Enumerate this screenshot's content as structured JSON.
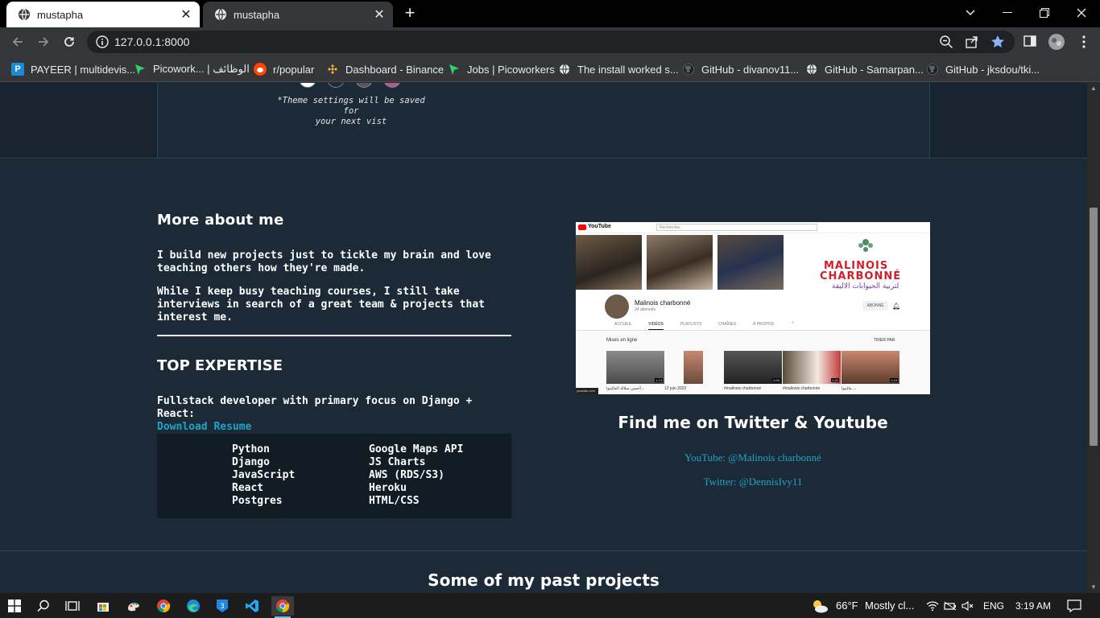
{
  "browser": {
    "tabs": [
      {
        "title": "mustapha",
        "active": false
      },
      {
        "title": "mustapha",
        "active": true
      }
    ],
    "url": "127.0.0.1:8000",
    "bookmarks": [
      {
        "label": "PAYEER | multidevis...",
        "icon": "payeer-icon"
      },
      {
        "label": "Picowork... | الوظائف",
        "icon": "picoworkers-icon"
      },
      {
        "label": "r/popular",
        "icon": "reddit-icon"
      },
      {
        "label": "Dashboard - Binance",
        "icon": "binance-icon"
      },
      {
        "label": "Jobs | Picoworkers",
        "icon": "picoworkers-icon"
      },
      {
        "label": "The install worked s...",
        "icon": "globe-icon"
      },
      {
        "label": "GitHub - divanov11...",
        "icon": "github-icon"
      },
      {
        "label": "GitHub - Samarpan...",
        "icon": "globe-icon"
      },
      {
        "label": "GitHub - jksdou/tki...",
        "icon": "github-icon"
      }
    ]
  },
  "theme": {
    "note_line1": "*Theme settings will be saved for",
    "note_line2": "your next vist"
  },
  "about": {
    "heading": "More about me",
    "para1_line1": "I build new projects just to tickle my brain and love",
    "para1_line2": "teaching others how they're made.",
    "para2_line1": "While I keep busy teaching courses, I still take",
    "para2_line2": "interviews in search of a great team & projects that",
    "para2_line3": "interest me."
  },
  "expertise": {
    "heading": "TOP EXPERTISE",
    "focus": "Fullstack developer with primary focus on Django + React:",
    "resume_link": "Download Resume",
    "skills_left": [
      "Python",
      "Django",
      "JavaScript",
      "React",
      "Postgres"
    ],
    "skills_right": [
      "Google Maps API",
      "JS Charts",
      "AWS (RDS/S3)",
      "Heroku",
      "HTML/CSS"
    ]
  },
  "youtube_screenshot": {
    "logo_text": "YouTube",
    "search_placeholder": "Rechercher",
    "banner_title_1": "MALINOIS",
    "banner_title_2": "CHARBONNÉ",
    "banner_arabic": "لتربية الحيوانات الاليفة",
    "channel_name": "Malinois charbonné",
    "subscribers": "24 abonnés",
    "subscribe_label": "ABONNÉ",
    "tabs": [
      "ACCUEIL",
      "VIDÉOS",
      "PLAYLISTS",
      "CHAÎNES",
      "À PROPOS"
    ],
    "section_label": "Mises en ligne",
    "sort_label": "TRIER PAR",
    "durations": [
      "1:13",
      "",
      "0:26",
      "0:32",
      "0:19"
    ],
    "video_titles": [
      "أحسن سلالة المالينوا...",
      "12 juin 2022",
      "#malinois charbonné",
      "#malinois charbonne",
      "مالينوا ..."
    ],
    "corner_text": "youtube.com"
  },
  "social": {
    "heading": "Find me on Twitter & Youtube",
    "youtube": "YouTube: @Malinois charbonné",
    "twitter": "Twitter: @DennisIvy11"
  },
  "projects": {
    "heading": "Some of my past projects"
  },
  "taskbar": {
    "weather_temp": "66°F",
    "weather_desc": "Mostly cl...",
    "language": "ENG",
    "time": "3:19 AM"
  },
  "colors": {
    "page_bg": "#1b2a36",
    "accent_link": "#1ea4c8",
    "skills_bg": "#111c24"
  }
}
